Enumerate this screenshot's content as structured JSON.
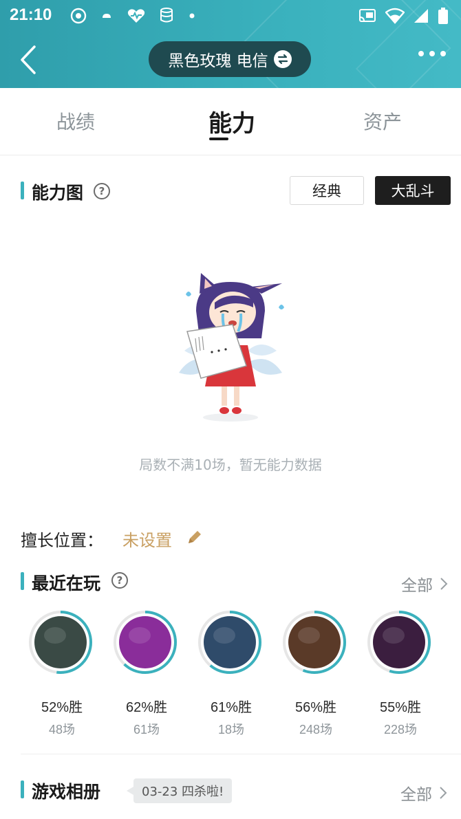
{
  "status_bar": {
    "time": "21:10",
    "left_icons": [
      "app-icon",
      "cloud-icon",
      "health-icon",
      "database-icon",
      "dot-icon"
    ],
    "right_icons": [
      "cast-icon",
      "wifi-icon",
      "signal-icon",
      "battery-icon"
    ]
  },
  "nav": {
    "title": "黑色玫瑰 电信",
    "back_icon": "chevron-left-icon",
    "swap_icon": "swap-icon",
    "more_icon": "more-icon"
  },
  "tabs": [
    {
      "label": "战绩",
      "active": false
    },
    {
      "label": "能力",
      "active": true
    },
    {
      "label": "资产",
      "active": false
    }
  ],
  "ability": {
    "title": "能力图",
    "help_icon": "help-icon",
    "modes": [
      {
        "label": "经典",
        "selected": false
      },
      {
        "label": "大乱斗",
        "selected": true
      }
    ],
    "empty_text": "局数不满10场，暂无能力数据"
  },
  "position": {
    "label": "擅长位置：",
    "value": "未设置",
    "edit_icon": "pencil-icon"
  },
  "recent": {
    "title": "最近在玩",
    "all_label": "全部",
    "champions": [
      {
        "win_rate": "52%胜",
        "games": "48场",
        "win_fraction": 0.52,
        "art": "#3a4a45"
      },
      {
        "win_rate": "62%胜",
        "games": "61场",
        "win_fraction": 0.62,
        "art": "#8a2d9a"
      },
      {
        "win_rate": "61%胜",
        "games": "18场",
        "win_fraction": 0.61,
        "art": "#2f4b6a"
      },
      {
        "win_rate": "56%胜",
        "games": "248场",
        "win_fraction": 0.56,
        "art": "#5a3a28"
      },
      {
        "win_rate": "55%胜",
        "games": "228场",
        "win_fraction": 0.55,
        "art": "#3b1e3f"
      }
    ]
  },
  "album": {
    "title": "游戏相册",
    "tooltip": "03-23 四杀啦!",
    "all_label": "全部"
  },
  "colors": {
    "accent": "#3bb1bd",
    "ring_track": "#e6e6e6",
    "header": "#3ab1bd",
    "position_value": "#c9a063"
  }
}
